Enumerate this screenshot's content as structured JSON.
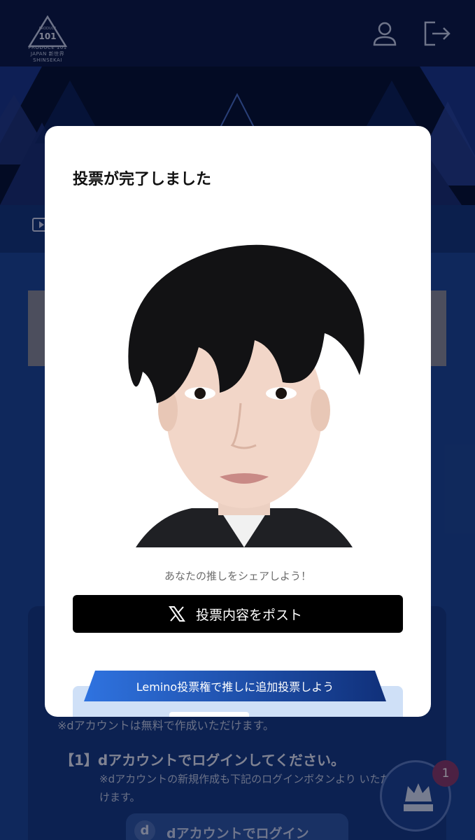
{
  "header": {
    "logo_text": "PRODUCE 101 JAPAN 新世界 SHINSEKAI",
    "icons": [
      "user-icon",
      "logout-icon"
    ]
  },
  "background": {
    "free_note": "※dアカウントは無料で作成いただけます。",
    "step1_title": "【1】dアカウントでログインしてください。",
    "step1_note": "※dアカウントの新規作成も下記のログインボタンより いただけます。",
    "login_label": "dアカウントでログイン",
    "badge_count": "1"
  },
  "modal": {
    "title": "投票が完了しました",
    "share_text": "あなたの推しをシェアしよう！",
    "post_label": "投票内容をポスト",
    "lemino_label": "Lemino投票権で推しに追加投票しよう"
  },
  "colors": {
    "header_bg": "#0b1d45",
    "page_bg": "#1d4a98",
    "modal_bg": "#ffffff",
    "post_button": "#000000",
    "ribbon_start": "#2f73e0",
    "ribbon_end": "#10307a",
    "badge": "#8a3d6b"
  }
}
